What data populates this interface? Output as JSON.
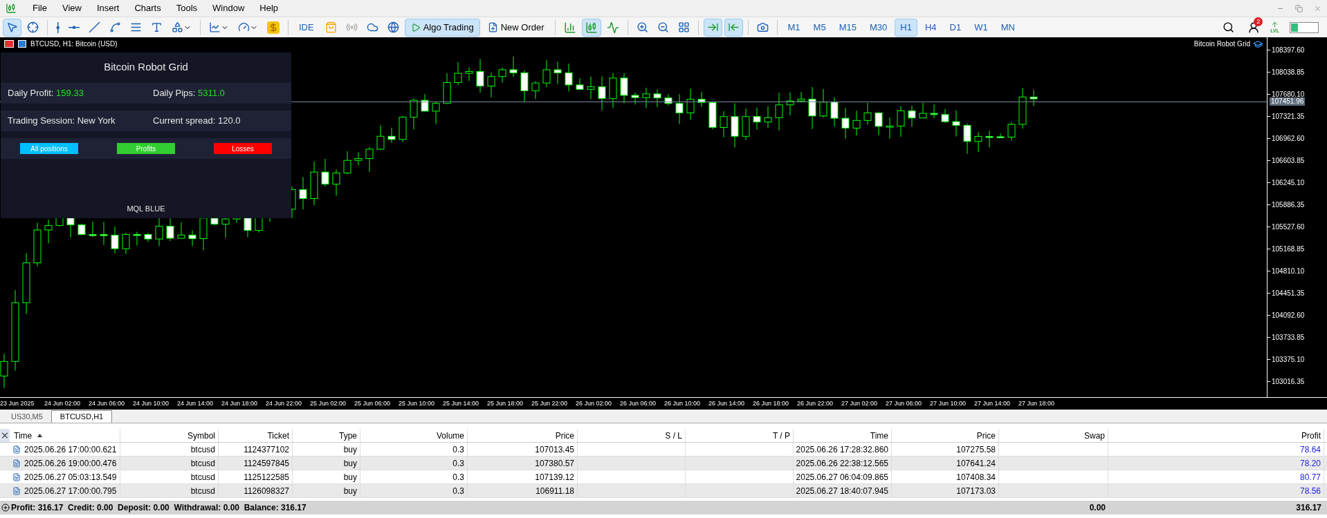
{
  "menu": [
    "File",
    "View",
    "Insert",
    "Charts",
    "Tools",
    "Window",
    "Help"
  ],
  "toolbar": {
    "ide": "IDE",
    "algo_trading": {
      "label": "Algo Trading",
      "on": true
    },
    "new_order": "New Order",
    "chart_types": [
      {
        "kind": "bars",
        "selected": false
      },
      {
        "kind": "candles",
        "selected": true
      },
      {
        "kind": "line",
        "selected": false
      }
    ],
    "auto_scroll": {
      "on": true
    },
    "chart_shift": {
      "on": true
    },
    "timeframes": [
      {
        "label": "M1",
        "selected": false
      },
      {
        "label": "M5",
        "selected": false
      },
      {
        "label": "M15",
        "selected": false
      },
      {
        "label": "M30",
        "selected": false
      },
      {
        "label": "H1",
        "selected": true
      },
      {
        "label": "H4",
        "selected": false
      },
      {
        "label": "D1",
        "selected": false
      },
      {
        "label": "W1",
        "selected": false
      },
      {
        "label": "MN",
        "selected": false
      }
    ],
    "notification_count": "2",
    "level_label": "LVL"
  },
  "chart": {
    "title": "BTCUSD, H1:  Bitcoin (USD)",
    "expert": "Bitcoin Robot Grid",
    "current_price": "107451.96",
    "price_ticks": [
      "108397.60",
      "108038.85",
      "107680.10",
      "107321.35",
      "106962.60",
      "106603.85",
      "106245.10",
      "105886.35",
      "105527.60",
      "105168.85",
      "104810.10",
      "104451.35",
      "104092.60",
      "103733.85",
      "103375.10",
      "103016.35"
    ],
    "time_ticks": [
      "23 Jun 2025",
      "24 Jun 02:00",
      "24 Jun 06:00",
      "24 Jun 10:00",
      "24 Jun 14:00",
      "24 Jun 18:00",
      "24 Jun 22:00",
      "25 Jun 02:00",
      "25 Jun 06:00",
      "25 Jun 10:00",
      "25 Jun 14:00",
      "25 Jun 18:00",
      "25 Jun 22:00",
      "26 Jun 02:00",
      "26 Jun 06:00",
      "26 Jun 10:00",
      "26 Jun 14:00",
      "26 Jun 18:00",
      "26 Jun 22:00",
      "27 Jun 02:00",
      "27 Jun 06:00",
      "27 Jun 10:00",
      "27 Jun 14:00",
      "27 Jun 18:00"
    ]
  },
  "panel": {
    "title": "Bitcoin Robot Grid",
    "rows": [
      [
        {
          "label": "Daily Profit:",
          "value": "159.33",
          "positive": true
        },
        {
          "label": "Daily Pips:",
          "value": "5311.0",
          "positive": true
        }
      ],
      [
        {
          "label": "Trading Session:",
          "value": "New York",
          "positive": false
        },
        {
          "label": "Current spread:",
          "value": "120.0",
          "positive": false
        }
      ]
    ],
    "buttons": [
      {
        "label": "All positions",
        "color": "#00bfff"
      },
      {
        "label": "Profits",
        "color": "#32cd32"
      },
      {
        "label": "Losses",
        "color": "#ff0000"
      }
    ],
    "footer": "MQL BLUE"
  },
  "tabs": [
    {
      "label": "US30,M5",
      "selected": false
    },
    {
      "label": "BTCUSD,H1",
      "selected": true
    }
  ],
  "table": {
    "columns": [
      {
        "label": "Time",
        "sorted": true
      },
      {
        "label": "Symbol",
        "sorted": false
      },
      {
        "label": "Ticket",
        "sorted": false
      },
      {
        "label": "Type",
        "sorted": false
      },
      {
        "label": "Volume",
        "sorted": false
      },
      {
        "label": "Price",
        "sorted": false
      },
      {
        "label": "S / L",
        "sorted": false
      },
      {
        "label": "T / P",
        "sorted": false
      },
      {
        "label": "Time",
        "sorted": false
      },
      {
        "label": "Price",
        "sorted": false
      },
      {
        "label": "Swap",
        "sorted": false
      },
      {
        "label": "Profit",
        "sorted": false
      }
    ],
    "rows": [
      [
        "2025.06.26 17:00:00.621",
        "btcusd",
        "1124377102",
        "buy",
        "0.3",
        "107013.45",
        "",
        "",
        "2025.06.26 17:28:32.860",
        "107275.58",
        "",
        "78.64"
      ],
      [
        "2025.06.26 19:00:00.476",
        "btcusd",
        "1124597845",
        "buy",
        "0.3",
        "107380.57",
        "",
        "",
        "2025.06.26 22:38:12.565",
        "107641.24",
        "",
        "78.20"
      ],
      [
        "2025.06.27 05:03:13.549",
        "btcusd",
        "1125122585",
        "buy",
        "0.3",
        "107139.12",
        "",
        "",
        "2025.06.27 06:04:09.865",
        "107408.34",
        "",
        "80.77"
      ],
      [
        "2025.06.27 17:00:00.795",
        "btcusd",
        "1126098327",
        "buy",
        "0.3",
        "106911.18",
        "",
        "",
        "2025.06.27 18:40:07.945",
        "107173.03",
        "",
        "78.56"
      ]
    ],
    "summary": "Profit: 316.17  Credit: 0.00  Deposit: 0.00  Withdrawal: 0.00  Balance: 316.17",
    "swap_total": "0.00",
    "profit_total": "316.17"
  }
}
